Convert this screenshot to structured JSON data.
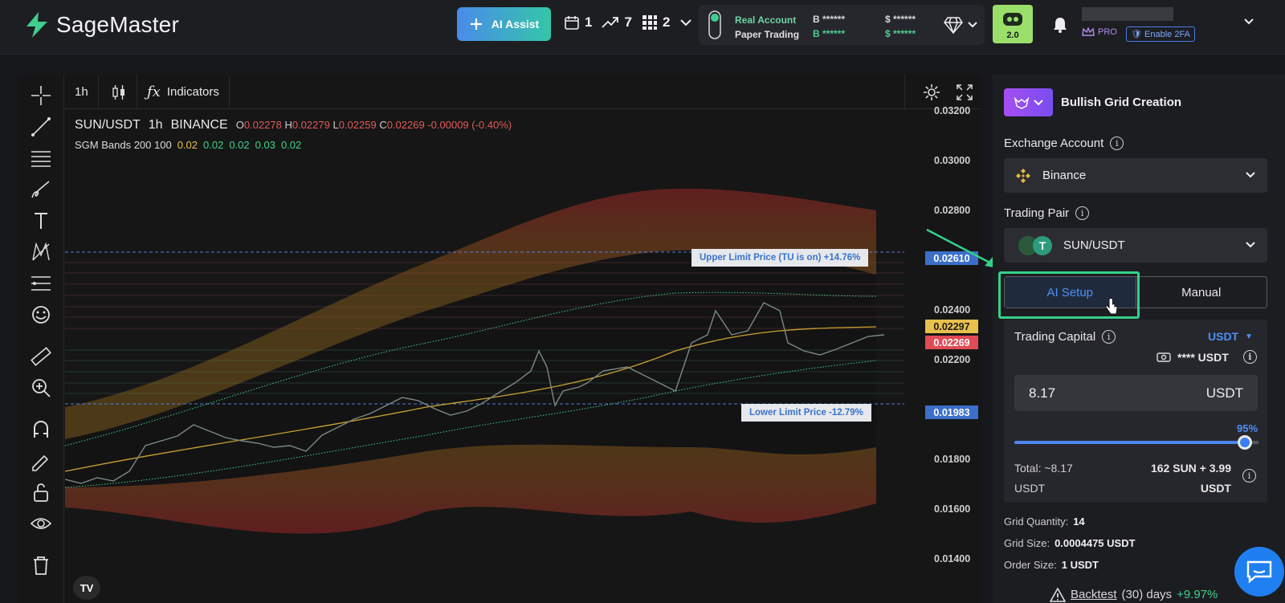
{
  "app": {
    "name": "SageMaster"
  },
  "topbar": {
    "ai_assist_label": "AI Assist",
    "counters": [
      "1",
      "7",
      "2"
    ],
    "account": {
      "real": "Real Account",
      "paper": "Paper Trading",
      "masked_b1": "B ******",
      "masked_b2": "B ******",
      "masked_s1": "$ ******",
      "masked_s2": "$ ******"
    },
    "bot_version": "2.0",
    "pro_label": "PRO",
    "twofa_label": "Enable 2FA"
  },
  "chart": {
    "timeframe": "1h",
    "indicators_label": "Indicators",
    "symbol": "SUN/USDT",
    "interval": "1h",
    "exchange": "BINANCE",
    "ohlc": {
      "o": "0.02278",
      "h": "0.02279",
      "l": "0.02259",
      "c": "0.02269",
      "chg": "-0.00009 (-0.40%)"
    },
    "indicator": {
      "name": "SGM Bands 200 100",
      "values": [
        "0.02",
        "0.02",
        "0.02",
        "0.03",
        "0.02"
      ]
    },
    "axis_ticks": [
      "0.03200",
      "0.03000",
      "0.02800",
      "0.02400",
      "0.02200",
      "0.01800",
      "0.01600",
      "0.01400"
    ],
    "price_tags": {
      "upper": "0.02610",
      "yellow": "0.02297",
      "red": "0.02269",
      "lower": "0.01983"
    },
    "upper_limit_label": "Upper Limit Price  (TU is on) +14.76%",
    "lower_limit_label": "Lower Limit Price  -12.79%"
  },
  "panel": {
    "title": "Bullish Grid Creation",
    "exchange_account_label": "Exchange Account",
    "exchange_value": "Binance",
    "trading_pair_label": "Trading Pair",
    "trading_pair_value": "SUN/USDT",
    "tab_ai": "AI Setup",
    "tab_manual": "Manual",
    "trading_capital_label": "Trading Capital",
    "currency_select": "USDT",
    "balance": "**** USDT",
    "amount": "8.17",
    "amount_unit": "USDT",
    "percent": "95%",
    "total_label": "Total: ~8.17",
    "total_unit": "USDT",
    "split_value": "162 SUN + 3.99",
    "split_unit": "USDT",
    "grid_quantity_label": "Grid Quantity:",
    "grid_quantity": "14",
    "grid_size_label": "Grid Size:",
    "grid_size": "0.0004475 USDT",
    "order_size_label": "Order Size:",
    "order_size": "1 USDT",
    "backtest_label": "Backtest",
    "backtest_days": "(30) days",
    "backtest_pct": "+9.97%"
  }
}
